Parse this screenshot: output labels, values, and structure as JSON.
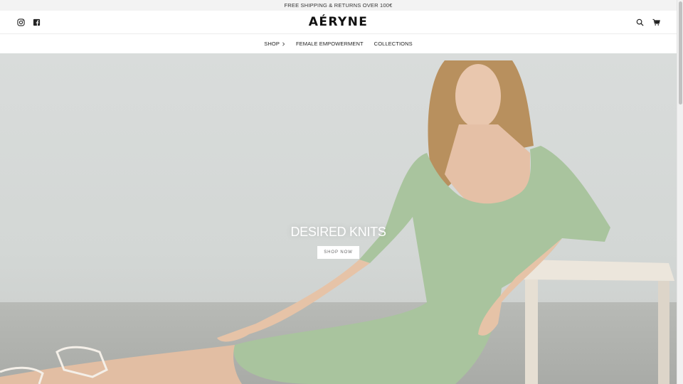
{
  "announcement": {
    "text": "FREE SHIPPING & RETURNS OVER 100€"
  },
  "header": {
    "logo": "AÉRYNE",
    "social": [
      {
        "icon": "instagram-icon"
      },
      {
        "icon": "facebook-icon"
      }
    ],
    "actions": [
      {
        "icon": "search-icon"
      },
      {
        "icon": "cart-icon"
      }
    ]
  },
  "nav": {
    "items": [
      {
        "label": "SHOP",
        "has_chevron": true
      },
      {
        "label": "FEMALE EMPOWERMENT"
      },
      {
        "label": "COLLECTIONS"
      }
    ]
  },
  "hero": {
    "title": "DESIRED KNITS",
    "button": "SHOP NOW"
  },
  "colors": {
    "accent": "#1a1a1a",
    "dress": "#a9c49e",
    "announcement_bg": "#f3f3f3"
  }
}
